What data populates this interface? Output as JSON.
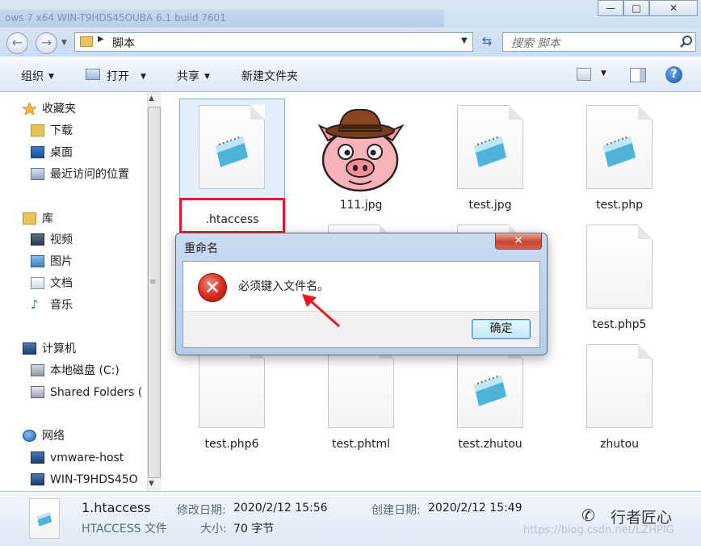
{
  "window": {
    "bg_title": "ows 7 x64 WIN-T9HDS45OUBA 6.1 build 7601",
    "minimize": "—",
    "maximize": "□",
    "close": "✕"
  },
  "address": {
    "back": "←",
    "forward": "→",
    "path": "脚本",
    "search_placeholder": "搜索 脚本",
    "refresh": "⇆"
  },
  "toolbar": {
    "organize": "组织",
    "open": "打开",
    "share": "共享",
    "new_folder": "新建文件夹",
    "help": "?"
  },
  "sidebar": {
    "items": [
      {
        "label": "收藏夹",
        "icon": "star-icon"
      },
      {
        "label": "下载",
        "icon": "download-folder-icon"
      },
      {
        "label": "桌面",
        "icon": "desktop-icon"
      },
      {
        "label": "最近访问的位置",
        "icon": "recent-places-icon"
      },
      {
        "label": "库",
        "icon": "libraries-icon"
      },
      {
        "label": "视频",
        "icon": "videos-icon"
      },
      {
        "label": "图片",
        "icon": "pictures-icon"
      },
      {
        "label": "文档",
        "icon": "documents-icon"
      },
      {
        "label": "音乐",
        "icon": "music-icon"
      },
      {
        "label": "计算机",
        "icon": "computer-icon"
      },
      {
        "label": "本地磁盘 (C:)",
        "icon": "local-disk-icon"
      },
      {
        "label": "Shared Folders (",
        "icon": "shared-folders-icon"
      },
      {
        "label": "网络",
        "icon": "network-icon"
      },
      {
        "label": "vmware-host",
        "icon": "network-computer-icon"
      },
      {
        "label": "WIN-T9HDS45O",
        "icon": "network-computer-icon"
      }
    ]
  },
  "files": [
    {
      "name": ".htaccess",
      "icon": "notepad-icon"
    },
    {
      "name": "111.jpg",
      "icon": "pig-image-thumbnail"
    },
    {
      "name": "test.jpg",
      "icon": "notepad-icon"
    },
    {
      "name": "test.php",
      "icon": "notepad-icon"
    },
    {
      "name": "test.php5",
      "icon": "blank-file-icon"
    },
    {
      "name": "test.php6",
      "icon": "blank-file-icon"
    },
    {
      "name": "test.phtml",
      "icon": "blank-file-icon"
    },
    {
      "name": "test.zhutou",
      "icon": "notepad-icon"
    },
    {
      "name": "zhutou",
      "icon": "blank-file-icon"
    }
  ],
  "dialog": {
    "title": "重命名",
    "message": "必须键入文件名。",
    "ok": "确定",
    "close": "✕",
    "error_glyph": "✕"
  },
  "status": {
    "filename": "1.htaccess",
    "type": "HTACCESS 文件",
    "modified_label": "修改日期:",
    "modified_value": "2020/2/12 15:56",
    "size_label": "大小:",
    "size_value": "70 字节",
    "created_label": "创建日期:",
    "created_value": "2020/2/12 15:49"
  },
  "watermark": {
    "brand": "行者匠心",
    "url": "https://blog.csdn.net/LZHPIG"
  },
  "colors": {
    "highlight_box": "#e8191f",
    "selection": "#e3f0fc",
    "arrow": "#e8191f"
  }
}
